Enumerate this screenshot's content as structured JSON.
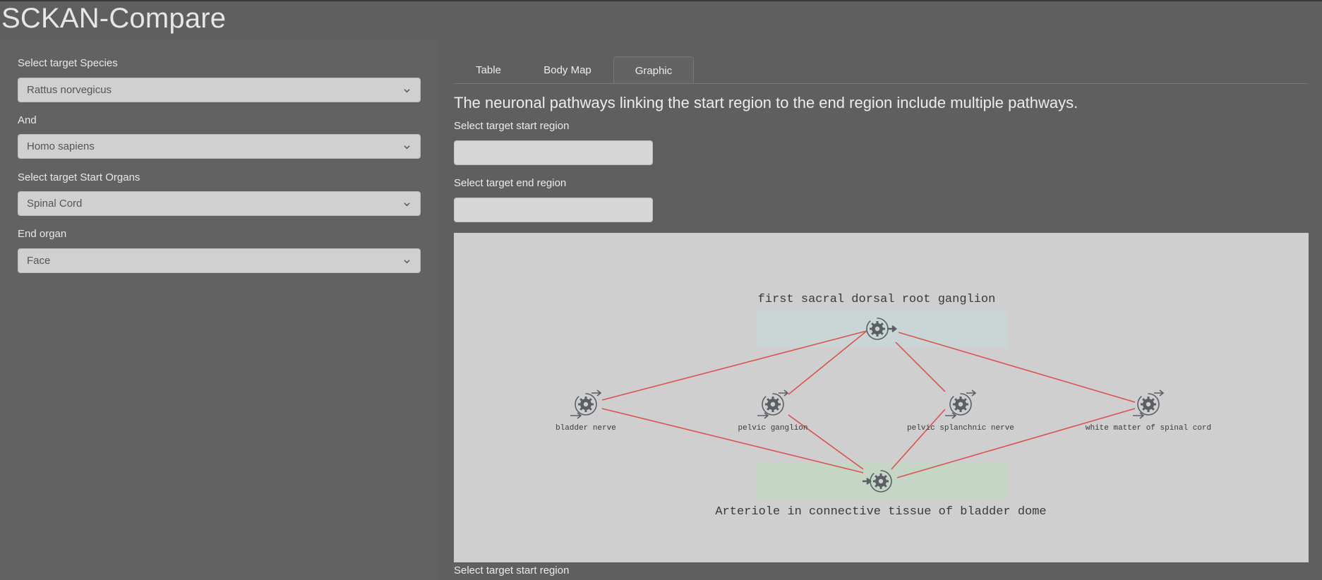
{
  "app": {
    "title": "SCKAN-Compare"
  },
  "sidebar": {
    "fields": [
      {
        "label": "Select target Species",
        "value": "Rattus norvegicus"
      },
      {
        "label": "And",
        "value": "Homo sapiens"
      },
      {
        "label": "Select target Start Organs",
        "value": "Spinal Cord"
      },
      {
        "label": "End organ",
        "value": "Face"
      }
    ]
  },
  "tabs": [
    {
      "label": "Table",
      "active": false
    },
    {
      "label": "Body Map",
      "active": false
    },
    {
      "label": "Graphic",
      "active": true
    }
  ],
  "main": {
    "headline": "The neuronal pathways linking the start region to the end region include multiple pathways.",
    "start_region_label": "Select target start region",
    "end_region_label": "Select target end region",
    "start_region_value": "",
    "end_region_value": "",
    "bottom_label": "Select target start region"
  },
  "graph": {
    "start_node": {
      "label": "first sacral dorsal root ganglion"
    },
    "end_node": {
      "label": "Arteriole in connective tissue of bladder dome"
    },
    "middle_nodes": [
      {
        "label": "bladder nerve"
      },
      {
        "label": "pelvic ganglion"
      },
      {
        "label": "pelvic splanchnic nerve"
      },
      {
        "label": "white matter of spinal cord"
      }
    ],
    "edge_color": "#d9534f"
  }
}
